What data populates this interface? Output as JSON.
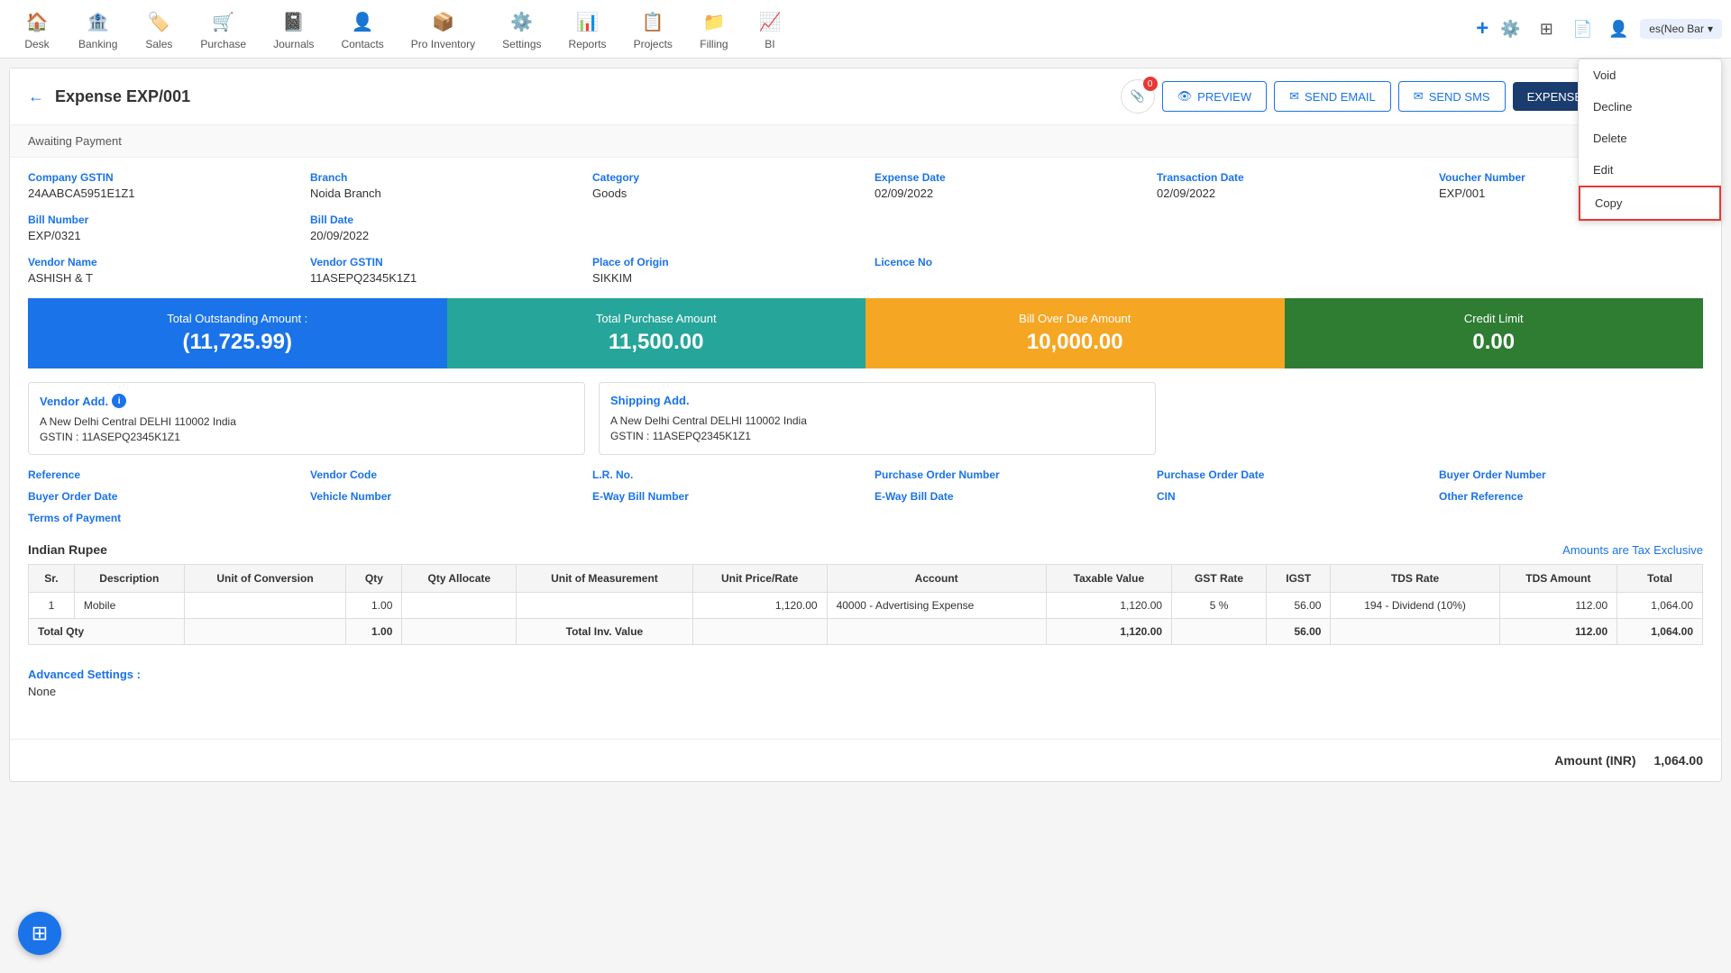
{
  "nav": {
    "items": [
      {
        "id": "desk",
        "label": "Desk",
        "icon": "🏠"
      },
      {
        "id": "banking",
        "label": "Banking",
        "icon": "🏦"
      },
      {
        "id": "sales",
        "label": "Sales",
        "icon": "🏷️"
      },
      {
        "id": "purchase",
        "label": "Purchase",
        "icon": "🛒"
      },
      {
        "id": "journals",
        "label": "Journals",
        "icon": "📓"
      },
      {
        "id": "contacts",
        "label": "Contacts",
        "icon": "👤"
      },
      {
        "id": "pro-inventory",
        "label": "Pro Inventory",
        "icon": "📦"
      },
      {
        "id": "settings",
        "label": "Settings",
        "icon": "⚙️"
      },
      {
        "id": "reports",
        "label": "Reports",
        "icon": "📊"
      },
      {
        "id": "projects",
        "label": "Projects",
        "icon": "📋"
      },
      {
        "id": "filling",
        "label": "Filling",
        "icon": "📁"
      },
      {
        "id": "bi",
        "label": "BI",
        "icon": "📈"
      }
    ],
    "user_label": "es(Neo Bar",
    "badge_count": "0"
  },
  "page": {
    "title": "Expense EXP/001",
    "status": "Awaiting Payment",
    "back_label": "←"
  },
  "actions": {
    "preview_label": "PREVIEW",
    "email_label": "SEND EMAIL",
    "sms_label": "SEND SMS",
    "options_label": "EXPENSE CLAIM OPTIONS",
    "dropdown_items": [
      {
        "id": "void",
        "label": "Void",
        "highlighted": false
      },
      {
        "id": "decline",
        "label": "Decline",
        "highlighted": false
      },
      {
        "id": "delete",
        "label": "Delete",
        "highlighted": false
      },
      {
        "id": "edit",
        "label": "Edit",
        "highlighted": false
      },
      {
        "id": "copy",
        "label": "Copy",
        "highlighted": true
      }
    ]
  },
  "expense": {
    "company_gstin_label": "Company GSTIN",
    "company_gstin_value": "24AABCA5951E1Z1",
    "branch_label": "Branch",
    "branch_value": "Noida Branch",
    "category_label": "Category",
    "category_value": "Goods",
    "expense_date_label": "Expense Date",
    "expense_date_value": "02/09/2022",
    "transaction_date_label": "Transaction Date",
    "transaction_date_value": "02/09/2022",
    "voucher_number_label": "Voucher Number",
    "voucher_number_value": "EXP/001",
    "bill_number_label": "Bill Number",
    "bill_number_value": "EXP/0321",
    "bill_date_label": "Bill Date",
    "bill_date_value": "20/09/2022",
    "vendor_name_label": "Vendor Name",
    "vendor_name_value": "ASHISH & T",
    "vendor_gstin_label": "Vendor GSTIN",
    "vendor_gstin_value": "11ASEPQ2345K1Z1",
    "place_of_origin_label": "Place of Origin",
    "place_of_origin_value": "SIKKIM",
    "licence_no_label": "Licence No",
    "licence_no_value": ""
  },
  "summary_cards": [
    {
      "id": "outstanding",
      "label": "Total Outstanding Amount :",
      "value": "(11,725.99)",
      "color": "blue"
    },
    {
      "id": "purchase",
      "label": "Total Purchase Amount",
      "value": "11,500.00",
      "color": "teal"
    },
    {
      "id": "overdue",
      "label": "Bill Over Due Amount",
      "value": "10,000.00",
      "color": "orange"
    },
    {
      "id": "credit",
      "label": "Credit Limit",
      "value": "0.00",
      "color": "green"
    }
  ],
  "addresses": {
    "vendor_label": "Vendor Add.",
    "vendor_line1": "A New Delhi Central DELHI 110002 India",
    "vendor_gstin_label": "GSTIN :",
    "vendor_gstin_value": "11ASEPQ2345K1Z1",
    "shipping_label": "Shipping Add.",
    "shipping_line1": "A New Delhi Central DELHI 110002 India",
    "shipping_gstin_label": "GSTIN :",
    "shipping_gstin_value": "11ASEPQ2345K1Z1"
  },
  "more_fields": {
    "reference_label": "Reference",
    "reference_value": "",
    "vendor_code_label": "Vendor Code",
    "vendor_code_value": "",
    "lr_no_label": "L.R. No.",
    "lr_no_value": "",
    "purchase_order_number_label": "Purchase Order Number",
    "purchase_order_number_value": "",
    "purchase_order_date_label": "Purchase Order Date",
    "purchase_order_date_value": "",
    "buyer_order_number_label": "Buyer Order Number",
    "buyer_order_number_value": "",
    "buyer_order_date_label": "Buyer Order Date",
    "buyer_order_date_value": "",
    "vehicle_number_label": "Vehicle Number",
    "vehicle_number_value": "",
    "eway_bill_number_label": "E-Way Bill Number",
    "eway_bill_number_value": "",
    "eway_bill_date_label": "E-Way Bill Date",
    "eway_bill_date_value": "",
    "cin_label": "CIN",
    "cin_value": "",
    "other_reference_label": "Other Reference",
    "other_reference_value": "",
    "terms_of_payment_label": "Terms of Payment",
    "terms_of_payment_value": ""
  },
  "table": {
    "currency_label": "Indian Rupee",
    "tax_exclusive_label": "Amounts are Tax Exclusive",
    "columns": [
      "Sr.",
      "Description",
      "Unit of Conversion",
      "Qty",
      "Qty Allocate",
      "Unit of Measurement",
      "Unit Price/Rate",
      "Account",
      "Taxable Value",
      "GST Rate",
      "IGST",
      "TDS Rate",
      "TDS Amount",
      "Total"
    ],
    "rows": [
      {
        "sr": "1",
        "description": "Mobile",
        "unit_of_conversion": "",
        "qty": "1.00",
        "qty_allocate": "",
        "unit_of_measurement": "",
        "unit_price_rate": "1,120.00",
        "account": "40000 - Advertising Expense",
        "taxable_value": "1,120.00",
        "gst_rate": "5 %",
        "igst": "56.00",
        "tds_rate": "194 - Dividend (10%)",
        "tds_amount": "112.00",
        "total": "1,064.00"
      }
    ],
    "total_row": {
      "label": "Total Qty",
      "qty": "1.00",
      "total_inv_label": "Total Inv. Value",
      "taxable_value": "1,120.00",
      "igst": "56.00",
      "tds_amount": "112.00",
      "total": "1,064.00"
    }
  },
  "advanced_settings": {
    "label": "Advanced Settings :",
    "value": "None"
  },
  "amount_footer": {
    "label": "Amount (INR)",
    "value": "1,064.00"
  }
}
